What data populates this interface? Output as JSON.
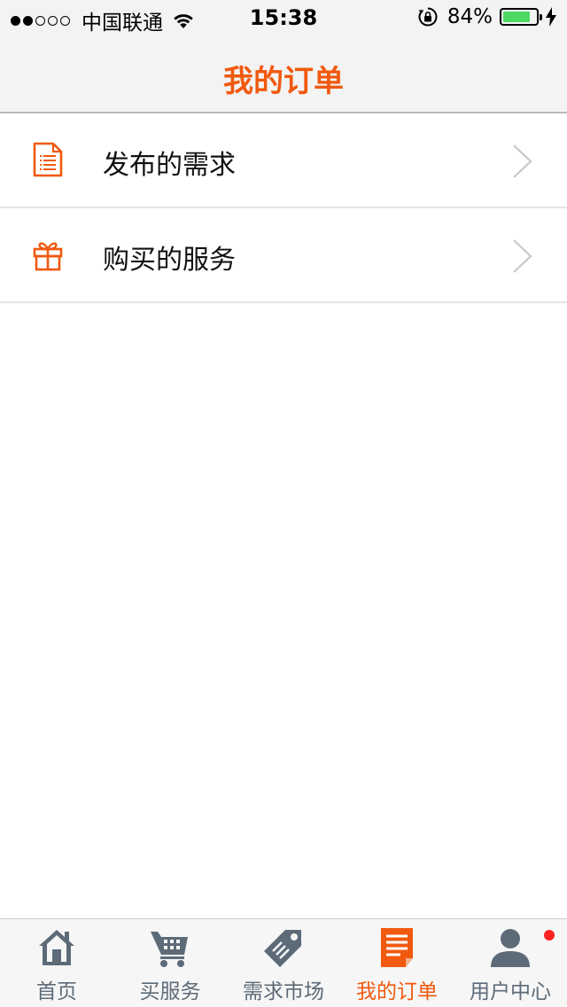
{
  "status_bar": {
    "carrier": "中国联通",
    "time": "15:38",
    "battery_percent": "84%",
    "battery_level": 0.84,
    "signal_bars": 2
  },
  "header": {
    "title": "我的订单"
  },
  "list": {
    "items": [
      {
        "label": "发布的需求",
        "icon": "document-list-icon"
      },
      {
        "label": "购买的服务",
        "icon": "gift-icon"
      }
    ]
  },
  "tab_bar": {
    "tabs": [
      {
        "label": "首页",
        "icon": "home-icon"
      },
      {
        "label": "买服务",
        "icon": "cart-icon"
      },
      {
        "label": "需求市场",
        "icon": "tag-icon"
      },
      {
        "label": "我的订单",
        "icon": "order-icon",
        "active": true
      },
      {
        "label": "用户中心",
        "icon": "user-icon",
        "has_badge": true
      }
    ]
  },
  "colors": {
    "accent": "#f0590e",
    "tab_inactive": "#5d6b78",
    "badge": "#ff2323",
    "battery": "#4cd964"
  }
}
